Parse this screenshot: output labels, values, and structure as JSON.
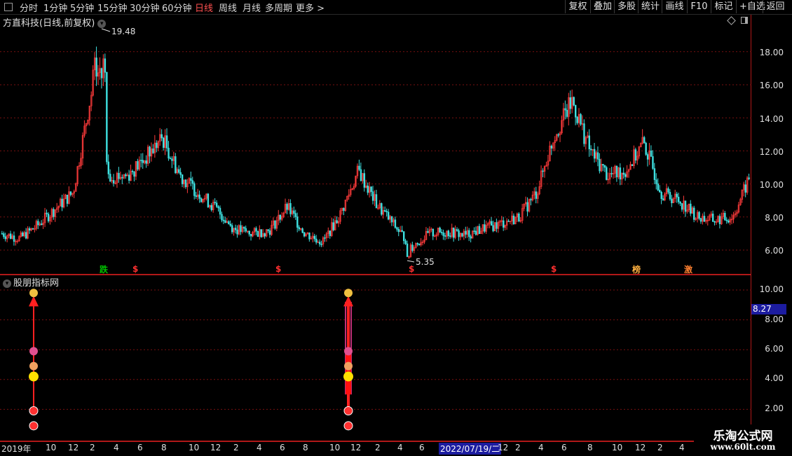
{
  "toolbar": {
    "periods": [
      "分时",
      "1分钟",
      "5分钟",
      "15分钟",
      "30分钟",
      "60分钟",
      "日线",
      "周线",
      "月线",
      "多周期",
      "更多"
    ],
    "active_period": "日线",
    "right_buttons": [
      "复权",
      "叠加",
      "多股",
      "统计",
      "画线",
      "F10",
      "标记",
      "+自选",
      "返回"
    ]
  },
  "main_chart": {
    "title": "方直科技(日线,前复权)",
    "y_ticks": [
      "18.00",
      "16.00",
      "14.00",
      "12.00",
      "10.00",
      "8.00",
      "6.00"
    ],
    "high_label": "19.48",
    "low_label": "5.35",
    "signals": [
      {
        "text": "跌",
        "color": "#00c000"
      },
      {
        "text": "$",
        "color": "#ff3030"
      },
      {
        "text": "$",
        "color": "#ff3030"
      },
      {
        "text": "$",
        "color": "#ff3030"
      },
      {
        "text": "$",
        "color": "#ff3030"
      },
      {
        "text": "榜",
        "color": "#ffb040"
      },
      {
        "text": "激",
        "color": "#ff8030"
      }
    ],
    "colors": {
      "up": "#ff3b3b",
      "down": "#3ee0e0",
      "grid": "#7a1010"
    },
    "chart_data": {
      "type": "line",
      "title": "",
      "y_range": [
        5.0,
        20.0
      ],
      "x_range": [
        "2019-09",
        "2023-04"
      ],
      "series": [
        {
          "x": [
            "2019-09",
            "2019-10",
            "2019-11",
            "2019-12",
            "2020-01",
            "2020-02",
            "2020-03",
            "2020-04",
            "2020-05",
            "2020-06",
            "2020-07",
            "2020-08",
            "2020-09",
            "2020-10",
            "2020-11",
            "2020-12",
            "2021-01",
            "2021-02",
            "2021-03",
            "2021-04",
            "2021-05",
            "2021-06",
            "2021-07",
            "2021-08",
            "2021-09",
            "2021-10",
            "2021-11",
            "2021-12",
            "2022-01",
            "2022-02",
            "2022-03",
            "2022-04",
            "2022-05",
            "2022-06",
            "2022-07",
            "2022-08",
            "2022-09",
            "2022-10",
            "2022-11",
            "2022-12",
            "2023-01",
            "2023-02",
            "2023-03"
          ],
          "values": [
            7.0,
            6.7,
            7.5,
            8.5,
            9.5,
            15.5,
            10.5,
            10.5,
            11.5,
            12.8,
            10.5,
            9.5,
            8.5,
            7.3,
            7.0,
            7.2,
            8.6,
            7.0,
            6.5,
            8.2,
            10.8,
            8.8,
            7.5,
            6.2,
            7.0,
            7.1,
            6.9,
            7.3,
            7.6,
            8.0,
            9.5,
            13.0,
            15.0,
            12.0,
            10.5,
            10.8,
            12.5,
            9.5,
            9.0,
            8.0,
            7.8,
            8.0,
            10.5
          ]
        }
      ],
      "annotations": [
        {
          "text": "19.48",
          "x": "2020-02",
          "y": 19.48
        },
        {
          "text": "5.35",
          "x": "2021-09",
          "y": 5.35
        }
      ]
    }
  },
  "indicator": {
    "title": "股朋指标网",
    "y_ticks": [
      "10.00",
      "8.00",
      "6.00",
      "4.00",
      "2.00"
    ],
    "current_value": "8.27"
  },
  "x_axis": {
    "labels": [
      "2019年",
      "10",
      "12",
      "2",
      "4",
      "6",
      "8",
      "10",
      "12",
      "2",
      "4",
      "6",
      "8",
      "10",
      "12",
      "2",
      "4",
      "6",
      "2022/07/19/二",
      "12",
      "2",
      "4",
      "6",
      "8",
      "10",
      "12",
      "2",
      "4"
    ]
  },
  "watermark": {
    "line1": "乐淘公式网",
    "line2": "www.60lt.com"
  }
}
